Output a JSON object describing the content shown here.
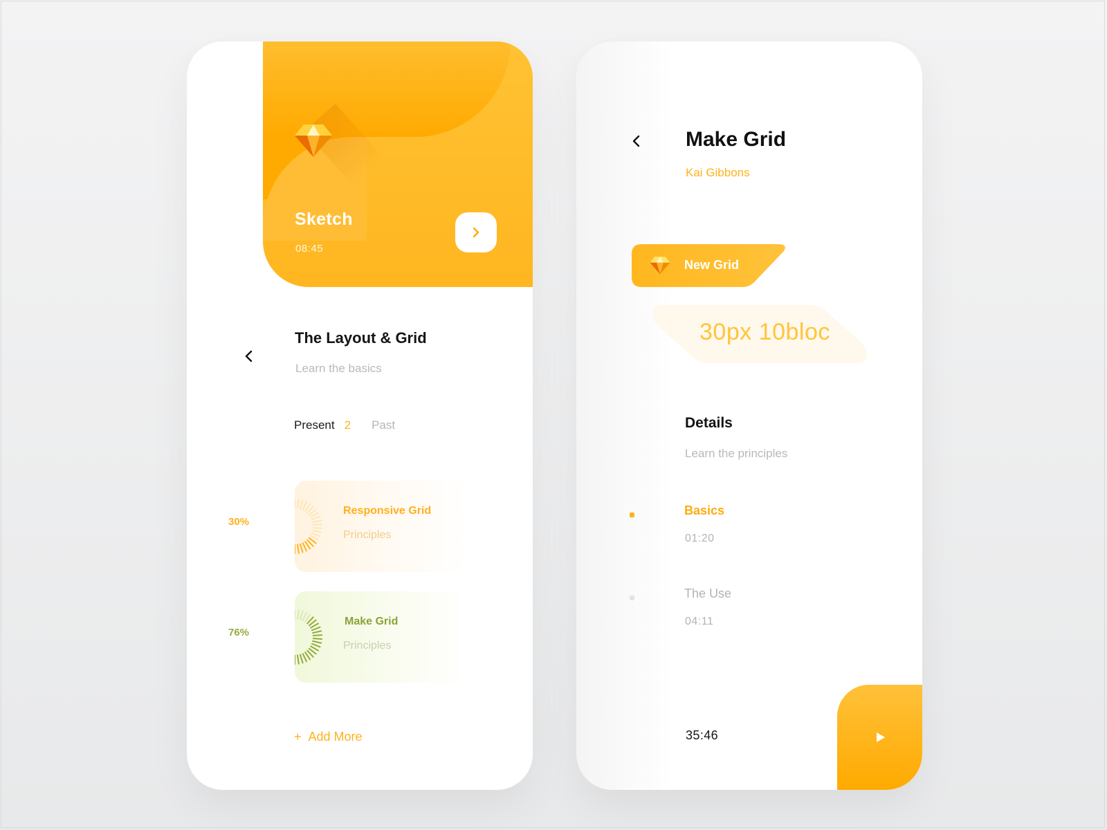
{
  "left": {
    "hero": {
      "title": "Sketch",
      "time": "08:45"
    },
    "course": {
      "title": "The Layout & Grid",
      "subtitle": "Learn the basics"
    },
    "tabs": {
      "present_label": "Present",
      "present_count": "2",
      "past_label": "Past"
    },
    "cards": [
      {
        "percent": "30%",
        "progress": 0.3,
        "title": "Responsive Grid",
        "subtitle": "Principles",
        "color": "#ffb21c"
      },
      {
        "percent": "76%",
        "progress": 0.76,
        "title": "Make Grid",
        "subtitle": "Principles",
        "color": "#93ad3c"
      }
    ],
    "add_more": {
      "plus": "+",
      "label": "Add More"
    }
  },
  "right": {
    "title": "Make Grid",
    "author": "Kai Gibbons",
    "pill_label": "New Grid",
    "ghost_text": "30px 10bloc",
    "details": {
      "title": "Details",
      "subtitle": "Learn the principles"
    },
    "lessons": [
      {
        "title": "Basics",
        "time": "01:20",
        "active": true
      },
      {
        "title": "The Use",
        "time": "04:11",
        "active": false
      }
    ],
    "total_time": "35:46"
  },
  "colors": {
    "accent": "#ffb21c",
    "accent_dark": "#ffaa00",
    "green": "#93ad3c"
  },
  "icons": [
    "sketch-logo-icon",
    "chevron-right-icon",
    "chevron-left-icon",
    "play-icon"
  ]
}
